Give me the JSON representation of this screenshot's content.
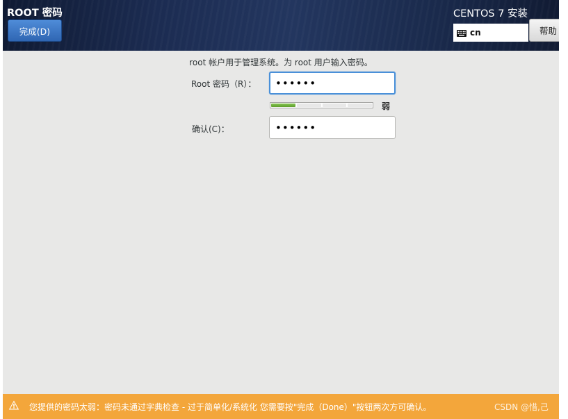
{
  "header": {
    "page_title": "ROOT 密码",
    "done_button": "完成(D)",
    "install_title": "CENTOS 7 安装",
    "keyboard_layout": "cn",
    "help_button": "帮助"
  },
  "form": {
    "instruction": "root 帐户用于管理系统。为 root 用户输入密码。",
    "password_label": "Root 密码（R）：",
    "password_value": "••••••",
    "strength_label": "弱",
    "strength_level": 0.25,
    "confirm_label": "确认(C)：",
    "confirm_value": "••••••"
  },
  "warning": {
    "text": "您提供的密码太弱：密码未通过字典检查 - 过于简单化/系统化 您需要按\"完成（Done）\"按钮两次方可确认。"
  },
  "watermark": "CSDN @惜,己",
  "colors": {
    "accent": "#4a90d9",
    "warning_bg": "#f3a63b",
    "strength_fill": "#6aa935"
  },
  "icons": {
    "keyboard": "keyboard-icon",
    "warning": "warning-triangle-icon"
  }
}
